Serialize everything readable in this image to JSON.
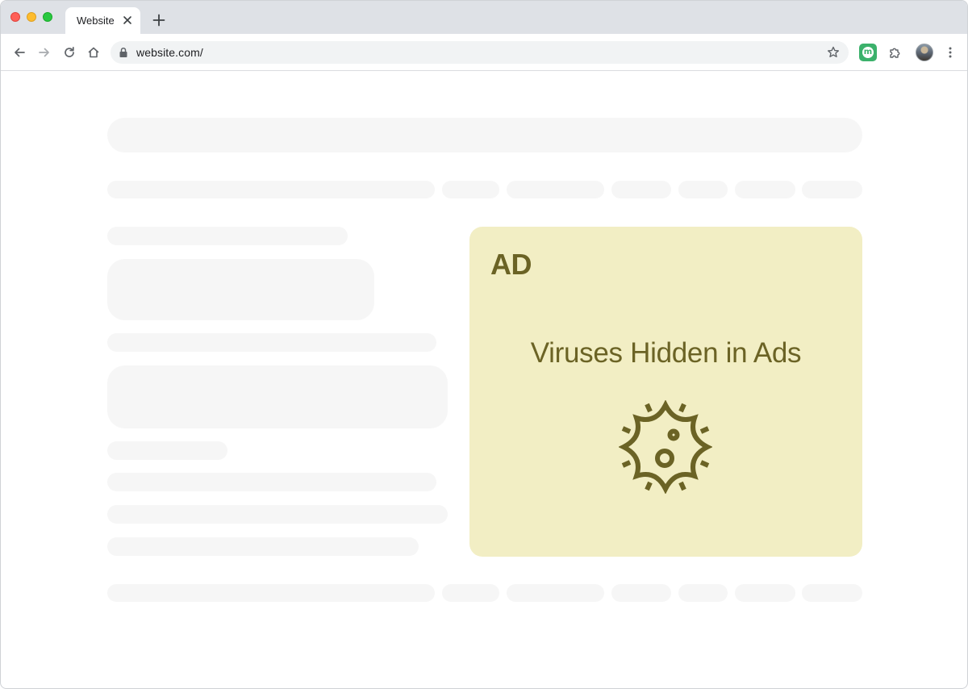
{
  "browser": {
    "tab": {
      "title": "Website"
    },
    "address_bar": {
      "url": "website.com/"
    }
  },
  "ad": {
    "label": "AD",
    "headline": "Viruses Hidden in Ads",
    "icon": "virus-icon"
  },
  "colors": {
    "ad_background": "#f2eec4",
    "ad_text": "#6b6325",
    "placeholder": "#f6f6f6",
    "tabstrip": "#dee1e6",
    "extension_green": "#3bb16b"
  },
  "extension": {
    "letter": "m"
  }
}
